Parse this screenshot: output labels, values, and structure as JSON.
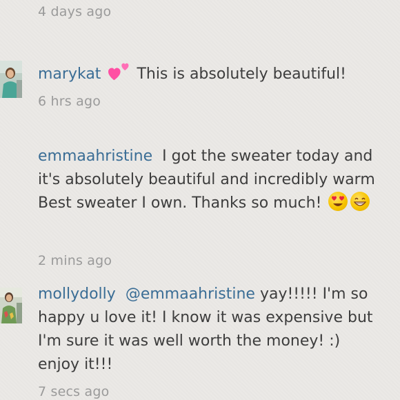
{
  "comments": [
    {
      "timestamp": "4 days ago"
    },
    {
      "username": "marykat",
      "text": "This is absolutely beautiful!",
      "timestamp": "6 hrs ago",
      "emoji_icons": [
        "two-hearts-icon"
      ]
    },
    {
      "username": "emmaahristine",
      "lines": [
        "I got the sweater today and",
        "it's absolutely beautiful and incredibly warm",
        "Best sweater I own. Thanks so much!"
      ],
      "timestamp": "2 mins ago",
      "emoji_icons": [
        "heart-eyes-emoji-icon",
        "grinning-emoji-icon"
      ]
    },
    {
      "username": "mollydolly",
      "mention": "@emmaahristine",
      "lines": [
        "yay!!!!! I'm so",
        "happy u love it! I know it was expensive but",
        "I'm sure it was well worth the money! :)",
        "enjoy it!!!"
      ],
      "timestamp": "7 secs ago"
    }
  ],
  "colors": {
    "background": "#ebe9e6",
    "username": "#3a6d95",
    "text": "#3d3d3d",
    "timestamp": "#9a9a9a",
    "heart_pink": "#ff4fa3"
  }
}
